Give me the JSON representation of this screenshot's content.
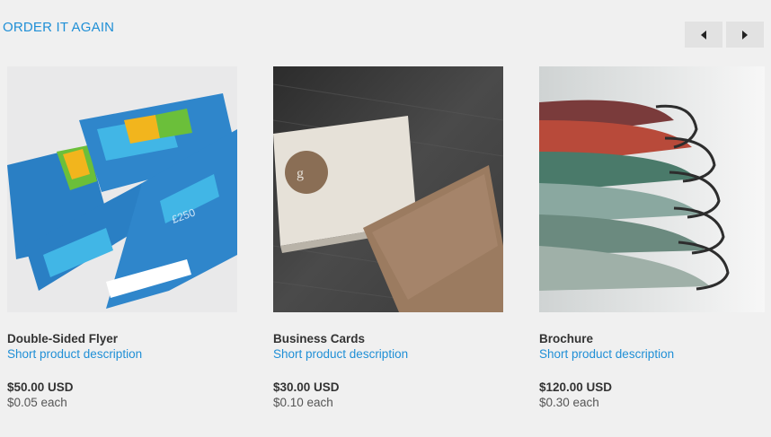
{
  "section": {
    "title": "ORDER IT AGAIN"
  },
  "carousel": {
    "prev_icon": "chevron-left-icon",
    "next_icon": "chevron-right-icon"
  },
  "products": [
    {
      "name": "Double-Sided Flyer",
      "description": "Short product description",
      "price": "$50.00 USD",
      "unit_price": "$0.05 each"
    },
    {
      "name": "Business Cards",
      "description": "Short product description",
      "price": "$30.00 USD",
      "unit_price": "$0.10 each"
    },
    {
      "name": "Brochure",
      "description": "Short product description",
      "price": "$120.00 USD",
      "unit_price": "$0.30 each"
    }
  ],
  "colors": {
    "accent": "#1f8fd6",
    "background": "#f0f0f0",
    "button": "#e2e2e2"
  }
}
